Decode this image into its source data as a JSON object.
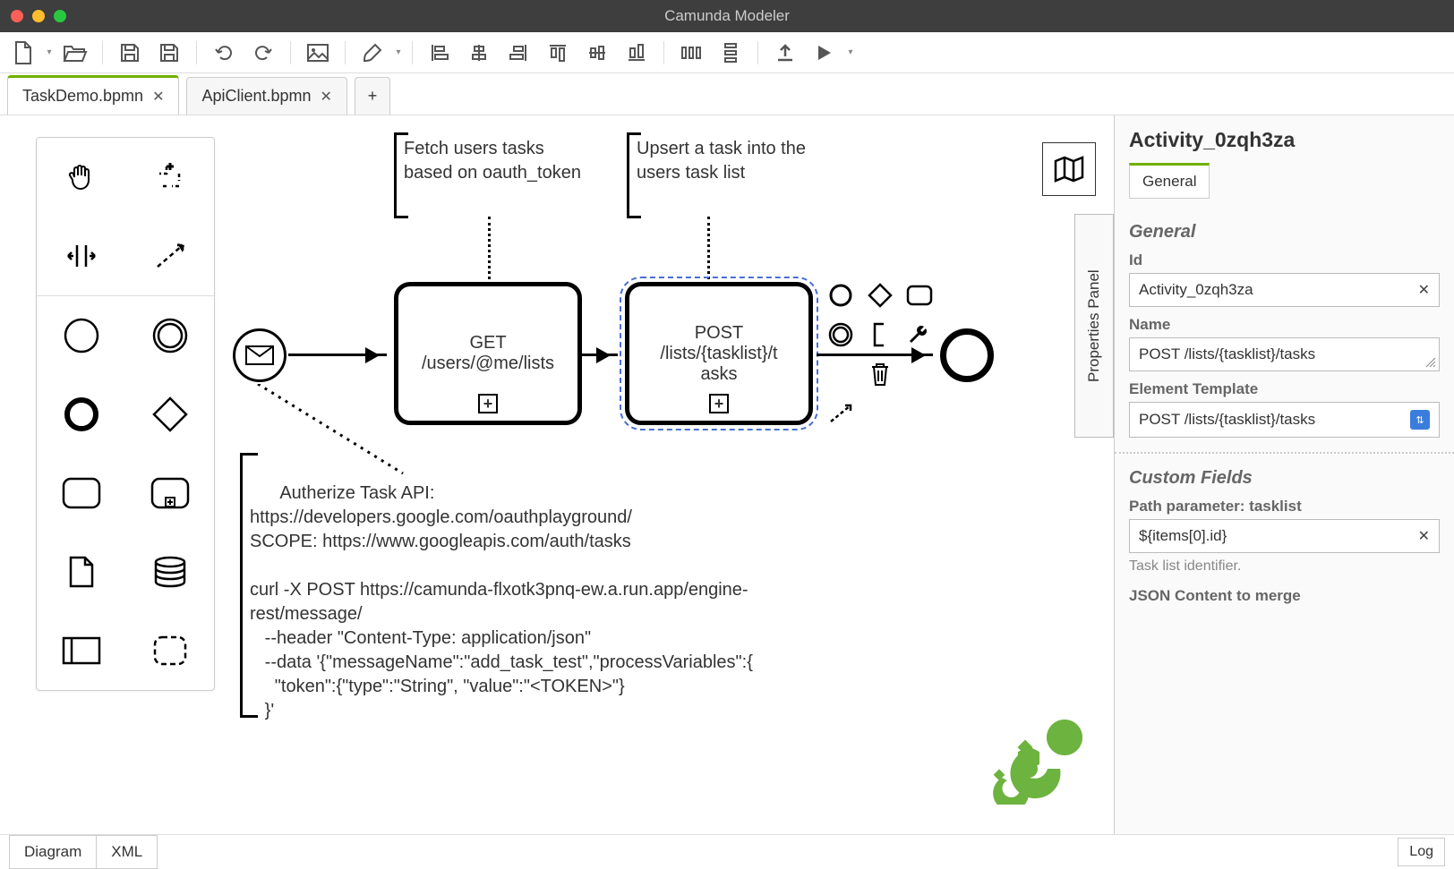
{
  "window": {
    "title": "Camunda Modeler"
  },
  "tabs": [
    {
      "label": "TaskDemo.bpmn",
      "active": true
    },
    {
      "label": "ApiClient.bpmn",
      "active": false
    }
  ],
  "annotations": {
    "fetch": "Fetch users tasks based on oauth_token",
    "upsert": "Upsert a task into the users task list",
    "note": "Autherize Task API: https://developers.google.com/oauthplayground/\nSCOPE: https://www.googleapis.com/auth/tasks\n\ncurl -X POST https://camunda-flxotk3pnq-ew.a.run.app/engine-rest/message/\n   --header \"Content-Type: application/json\"\n   --data '{\"messageName\":\"add_task_test\",\"processVariables\":{\n     \"token\":{\"type\":\"String\", \"value\":\"<TOKEN>\"}\n   }'"
  },
  "tasks": {
    "get": {
      "line1": "GET",
      "line2": "/users/@me/lists"
    },
    "post": {
      "line1": "POST",
      "line2": "/lists/{tasklist}/t",
      "line3": "asks"
    }
  },
  "propsPanelLabel": "Properties Panel",
  "panel": {
    "heading": "Activity_0zqh3za",
    "tab": "General",
    "sectionGeneral": "General",
    "idLabel": "Id",
    "idValue": "Activity_0zqh3za",
    "nameLabel": "Name",
    "nameValue": "POST /lists/{tasklist}/tasks",
    "templateLabel": "Element Template",
    "templateValue": "POST /lists/{tasklist}/tasks",
    "sectionCustom": "Custom Fields",
    "pathParamLabel": "Path parameter: tasklist",
    "pathParamValue": "${items[0].id}",
    "pathParamHint": "Task list identifier.",
    "jsonContentLabel": "JSON Content to merge"
  },
  "footer": {
    "diagram": "Diagram",
    "xml": "XML",
    "log": "Log"
  }
}
